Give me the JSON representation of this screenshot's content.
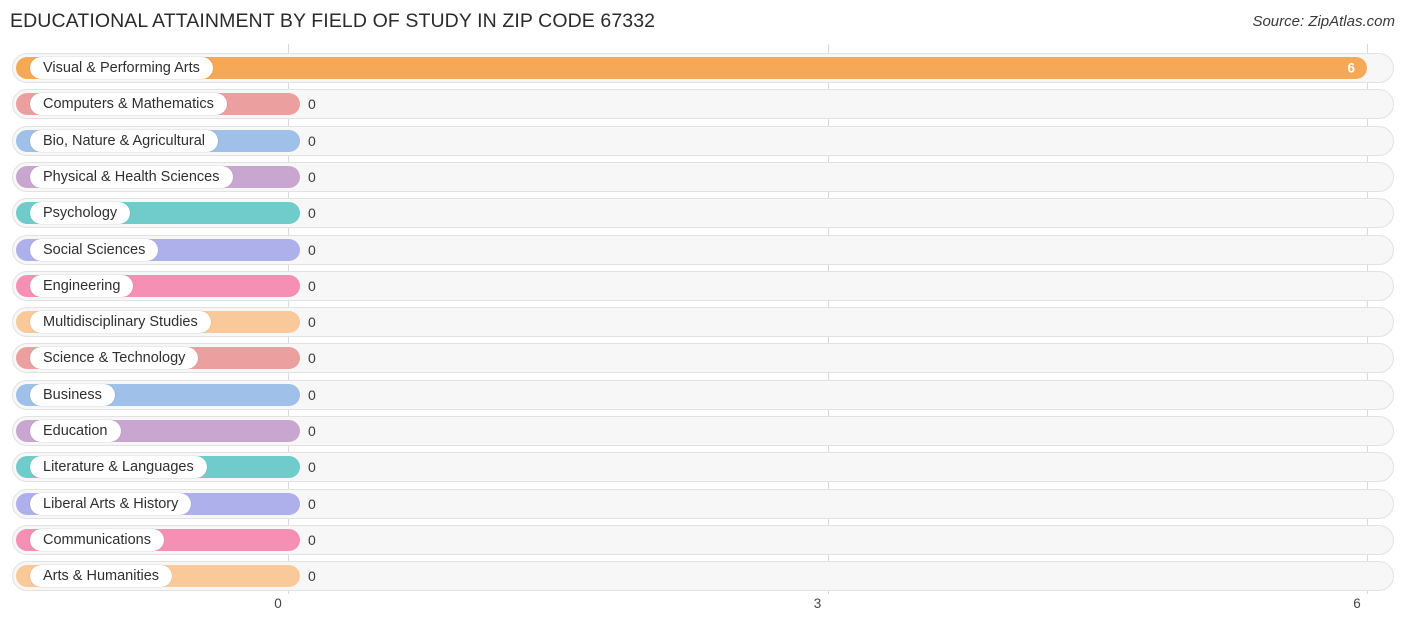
{
  "header": {
    "title": "EDUCATIONAL ATTAINMENT BY FIELD OF STUDY IN ZIP CODE 67332",
    "source": "Source: ZipAtlas.com"
  },
  "chart_data": {
    "type": "bar",
    "orientation": "horizontal",
    "title": "EDUCATIONAL ATTAINMENT BY FIELD OF STUDY IN ZIP CODE 67332",
    "xlabel": "",
    "ylabel": "",
    "xlim": [
      0,
      6
    ],
    "xticks": [
      "0",
      "3",
      "6"
    ],
    "xtick_values": [
      0,
      3,
      6
    ],
    "grid": true,
    "legend": false,
    "categories": [
      "Visual & Performing Arts",
      "Computers & Mathematics",
      "Bio, Nature & Agricultural",
      "Physical & Health Sciences",
      "Psychology",
      "Social Sciences",
      "Engineering",
      "Multidisciplinary Studies",
      "Science & Technology",
      "Business",
      "Education",
      "Literature & Languages",
      "Liberal Arts & History",
      "Communications",
      "Arts & Humanities"
    ],
    "values": [
      6,
      0,
      0,
      0,
      0,
      0,
      0,
      0,
      0,
      0,
      0,
      0,
      0,
      0,
      0
    ],
    "value_labels": [
      "6",
      "0",
      "0",
      "0",
      "0",
      "0",
      "0",
      "0",
      "0",
      "0",
      "0",
      "0",
      "0",
      "0",
      "0"
    ],
    "colors": [
      "#f5a855",
      "#eb9f9f",
      "#9fc0e8",
      "#c9a6cf",
      "#6fccca",
      "#aeb0ec",
      "#f590b4",
      "#fac999",
      "#eb9f9f",
      "#9fc0e8",
      "#c9a6cf",
      "#6fccca",
      "#aeb0ec",
      "#f590b4",
      "#fac999"
    ]
  }
}
